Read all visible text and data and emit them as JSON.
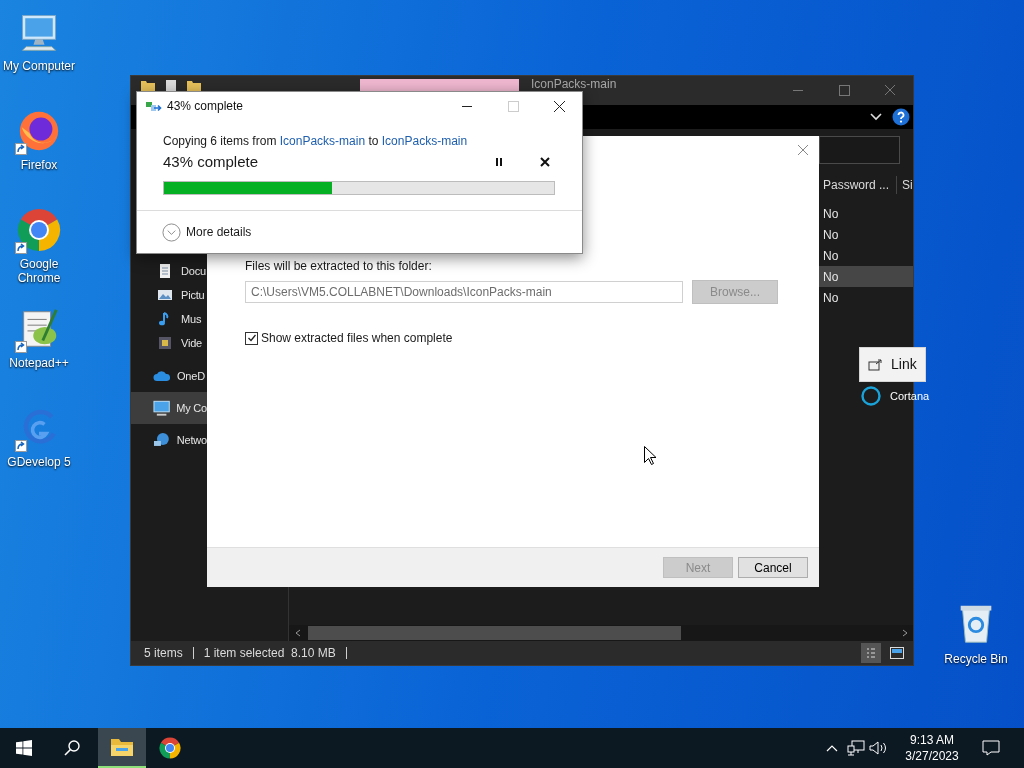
{
  "desktop_icons": [
    {
      "label": "My Computer",
      "kind": "computer",
      "shortcut": false
    },
    {
      "label": "Firefox",
      "kind": "firefox",
      "shortcut": true
    },
    {
      "label": "Google Chrome",
      "kind": "chrome",
      "shortcut": true
    },
    {
      "label": "Notepad++",
      "kind": "notepad",
      "shortcut": true
    },
    {
      "label": "GDevelop 5",
      "kind": "gdevelop",
      "shortcut": true
    }
  ],
  "recycle_bin": {
    "label": "Recycle Bin"
  },
  "explorer": {
    "title": "IconPacks-main",
    "nav_items": [
      {
        "label": "Docu",
        "kind": "sub",
        "selected": false
      },
      {
        "label": "Pictu",
        "kind": "sub",
        "selected": false
      },
      {
        "label": "Mus",
        "kind": "sub",
        "selected": false
      },
      {
        "label": "Vide",
        "kind": "sub",
        "selected": false
      },
      {
        "label": "OneD",
        "kind": "top",
        "selected": false
      },
      {
        "label": "My Co",
        "kind": "top",
        "selected": true
      },
      {
        "label": "Netwo",
        "kind": "top",
        "selected": false
      }
    ],
    "columns": [
      "Password ...",
      "Si"
    ],
    "rows": [
      {
        "password": "No",
        "selected": false
      },
      {
        "password": "No",
        "selected": false
      },
      {
        "password": "No",
        "selected": false
      },
      {
        "password": "No",
        "selected": true
      },
      {
        "password": "No",
        "selected": false
      }
    ],
    "status_items": [
      "5 items",
      "1 item selected  8.10 MB"
    ],
    "views": [
      {
        "kind": "details",
        "selected": true
      },
      {
        "kind": "tiles",
        "selected": false
      }
    ]
  },
  "extract_dialog": {
    "prompt": "Files will be extracted to this folder:",
    "path": "C:\\Users\\VM5.COLLABNET\\Downloads\\IconPacks-main",
    "browse": {
      "label": "Browse...",
      "disabled": true
    },
    "show_files": {
      "label": "Show extracted files when complete",
      "checked": true
    },
    "buttons": [
      {
        "label": "Next",
        "disabled": true
      },
      {
        "label": "Cancel",
        "disabled": false
      }
    ]
  },
  "progress_dialog": {
    "title": "43% complete",
    "controls": [
      {
        "kind": "minimize",
        "disabled": false
      },
      {
        "kind": "maximize",
        "disabled": true
      },
      {
        "kind": "close",
        "disabled": false
      }
    ],
    "message_parts": [
      {
        "text": "Copying 6 items from ",
        "link": false
      },
      {
        "text": "IconPacks-main",
        "link": true
      },
      {
        "text": " to ",
        "link": false
      },
      {
        "text": "IconPacks-main",
        "link": true
      }
    ],
    "status": "43% complete",
    "level": 0.43,
    "details": "More details"
  },
  "tooltip": {
    "label": "Link"
  },
  "cortana": {
    "label": "Cortana"
  },
  "taskbar": {
    "apps": [
      {
        "kind": "explorer",
        "active": true
      },
      {
        "kind": "chrome",
        "active": false
      }
    ],
    "time": "9:13 AM",
    "date": "3/27/2023"
  }
}
